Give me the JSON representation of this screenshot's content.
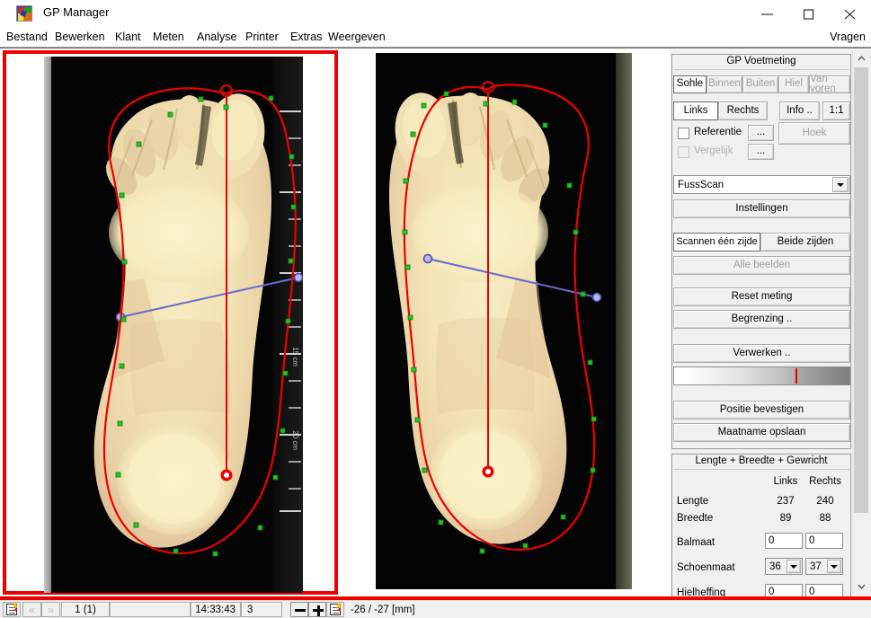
{
  "window": {
    "title": "GP Manager",
    "icon": "app-icon",
    "controls": {
      "minimize": "—",
      "maximize": "☐",
      "close": "✕"
    }
  },
  "menu": {
    "items": [
      "Bestand",
      "Bewerken",
      "Klant",
      "Meten",
      "Analyse",
      "Printer",
      "Extras",
      "Weergeven"
    ],
    "right_item": "Vragen"
  },
  "measurement_panel": {
    "group_title": "GP Voetmeting",
    "view_tabs": [
      {
        "label": "Sohle",
        "selected": true,
        "enabled": true
      },
      {
        "label": "Binnen",
        "selected": false,
        "enabled": false
      },
      {
        "label": "Buiten",
        "selected": false,
        "enabled": false
      },
      {
        "label": "Hiel",
        "selected": false,
        "enabled": false
      },
      {
        "label": "Van voren",
        "selected": false,
        "enabled": false
      }
    ],
    "side_tabs": [
      {
        "label": "Links",
        "selected": true
      },
      {
        "label": "Rechts",
        "selected": false
      }
    ],
    "info_button": "Info ..",
    "scale_button": "1:1",
    "angle_button": {
      "label": "Hoek",
      "enabled": false
    },
    "checkboxes": [
      {
        "label": "Referentie",
        "checked": false,
        "enabled": true,
        "browse": "..."
      },
      {
        "label": "Vergelijk",
        "checked": false,
        "enabled": false,
        "browse": "..."
      }
    ],
    "scanner_select": {
      "value": "FussScan",
      "options": [
        "FussScan"
      ]
    },
    "settings_button": "Instellingen",
    "scan_one_side": "Scannen één zijde",
    "scan_both_sides": "Beide zijden",
    "all_images": {
      "label": "Alle beelden",
      "enabled": false
    },
    "reset_button": "Reset meting",
    "boundary_button": "Begrenzing ..",
    "process_button": "Verwerken ..",
    "gradient": {
      "marker_percent": 68,
      "marker_color": "#e00000"
    },
    "confirm_position_button": "Positie bevestigen",
    "save_measurement_button": "Maatname opslaan"
  },
  "results_panel": {
    "group_title": "Lengte + Breedte + Gewricht",
    "column_headers": [
      "Links",
      "Rechts"
    ],
    "rows": [
      {
        "label": "Lengte",
        "left": "237",
        "right": "240",
        "type": "readonly"
      },
      {
        "label": "Breedte",
        "left": "89",
        "right": "88",
        "type": "readonly"
      },
      {
        "label": "Balmaat",
        "left": "0",
        "right": "0",
        "type": "text"
      },
      {
        "label": "Schoenmaat",
        "left": "36",
        "right": "37",
        "type": "select"
      },
      {
        "label": "Hielheffing",
        "left": "0",
        "right": "0",
        "type": "text"
      }
    ]
  },
  "scans": {
    "left": {
      "name": "left-foot-scan",
      "selected": true,
      "ruler_labels": [
        "15 cm",
        "20 cm"
      ]
    },
    "right": {
      "name": "right-foot-scan",
      "selected": false
    },
    "outline_color": "#ee0000",
    "node_color": "#22c522",
    "axis_color": "#ee0000",
    "width_line_color": "#6a6ad0"
  },
  "statusbar": {
    "new_icon": "new-document-icon",
    "prev_arrow": "«",
    "next_arrow": "»",
    "record": "1 (1)",
    "blank": "",
    "time": "14:33:43",
    "count": "3",
    "zoom_out": "−",
    "zoom_in": "+",
    "report_icon": "report-icon",
    "coordinates": "-26 / -27 [mm]"
  },
  "scrollbar": {
    "up": "⌃",
    "down": "⌄"
  }
}
